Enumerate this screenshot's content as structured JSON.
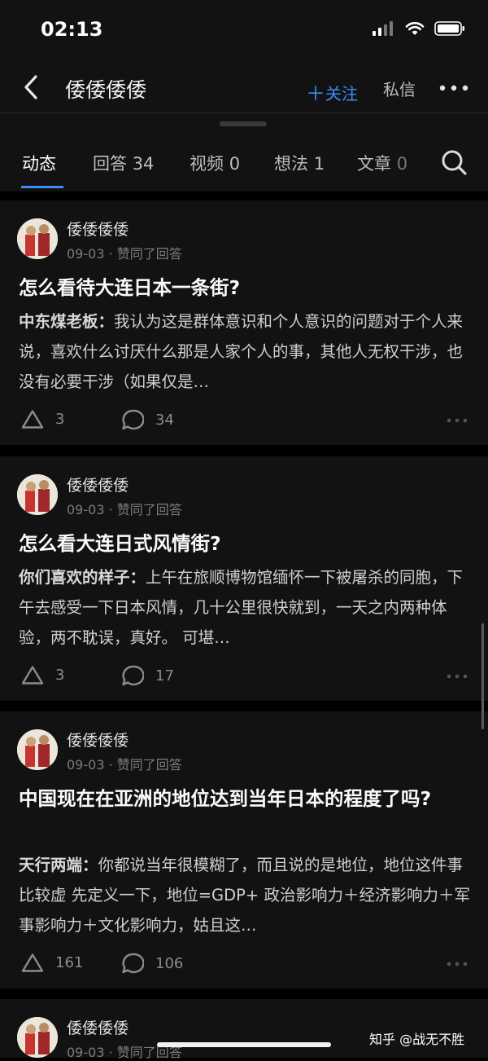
{
  "status": {
    "time": "02:13"
  },
  "header": {
    "title": "倭倭倭倭",
    "follow_label": "关注",
    "message_label": "私信"
  },
  "tabs": [
    {
      "label": "动态",
      "count": ""
    },
    {
      "label": "回答",
      "count": "34"
    },
    {
      "label": "视频",
      "count": "0"
    },
    {
      "label": "想法",
      "count": "1"
    },
    {
      "label": "文章",
      "count": "0"
    }
  ],
  "feed": [
    {
      "user": "倭倭倭倭",
      "meta": "09-03 · 赞同了回答",
      "question": "怎么看待大连日本一条街?",
      "author": "中东煤老板：",
      "excerpt": "我认为这是群体意识和个人意识的问题对于个人来说，喜欢什么讨厌什么那是人家个人的事，其他人无权干涉，也没有必要干涉（如果仅是…",
      "likes": "3",
      "comments": "34"
    },
    {
      "user": "倭倭倭倭",
      "meta": "09-03 · 赞同了回答",
      "question": "怎么看大连日式风情街?",
      "author": "你们喜欢的样子：",
      "excerpt": "上午在旅顺博物馆缅怀一下被屠杀的同胞，下午去感受一下日本风情，几十公里很快就到，一天之内两种体验，两不耽误，真好。 可堪…",
      "likes": "3",
      "comments": "17"
    },
    {
      "user": "倭倭倭倭",
      "meta": "09-03 · 赞同了回答",
      "question": "中国现在在亚洲的地位达到当年日本的程度了吗?",
      "author": "天行两端：",
      "excerpt": "你都说当年很模糊了，而且说的是地位，地位这件事比较虚 先定义一下，地位=GDP+ 政治影响力＋经济影响力＋军事影响力＋文化影响力，姑且这…",
      "likes": "161",
      "comments": "106"
    },
    {
      "user": "倭倭倭倭",
      "meta": "09-03 · 赞同了回答"
    }
  ],
  "watermark": "知乎 @战无不胜",
  "colors": {
    "accent": "#3a8cf7",
    "background": "#000000",
    "card": "#121212"
  }
}
